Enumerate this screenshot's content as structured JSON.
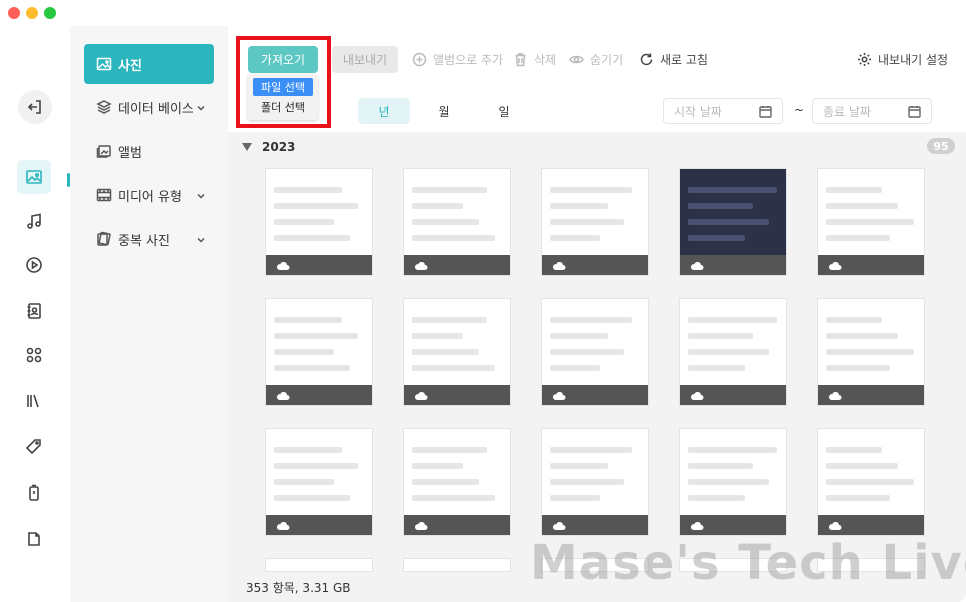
{
  "sidebar": {
    "items": [
      {
        "label": "사진",
        "icon": "image-icon",
        "active": true,
        "expandable": false
      },
      {
        "label": "데이터 베이스",
        "icon": "layers-icon",
        "active": false,
        "expandable": true
      },
      {
        "label": "앨범",
        "icon": "album-icon",
        "active": false,
        "expandable": false
      },
      {
        "label": "미디어 유형",
        "icon": "film-icon",
        "active": false,
        "expandable": true
      },
      {
        "label": "중복 사진",
        "icon": "duplicate-icon",
        "active": false,
        "expandable": true
      }
    ]
  },
  "toolbar": {
    "import_label": "가져오기",
    "export_label": "내보내기",
    "add_to_album_label": "앨범으로 추가",
    "delete_label": "삭제",
    "hide_label": "숨기기",
    "refresh_label": "새로 고침",
    "export_settings_label": "내보내기 설정"
  },
  "import_menu": {
    "file_select": "파일 선택",
    "folder_select": "폴더 선택"
  },
  "filter": {
    "year": "년",
    "month": "월",
    "day": "일",
    "start_date_placeholder": "시작 날짜",
    "separator": "~",
    "end_date_placeholder": "종료 날짜"
  },
  "gallery": {
    "section_title": "2023",
    "section_count": "95"
  },
  "status": {
    "summary": "353 항목, 3.31 GB"
  },
  "watermark": "Mase's Tech Live",
  "colors": {
    "accent": "#2bb6be",
    "import_button": "#5dc8c3",
    "highlight": "#e8131a",
    "selection": "#3a8ef6"
  }
}
